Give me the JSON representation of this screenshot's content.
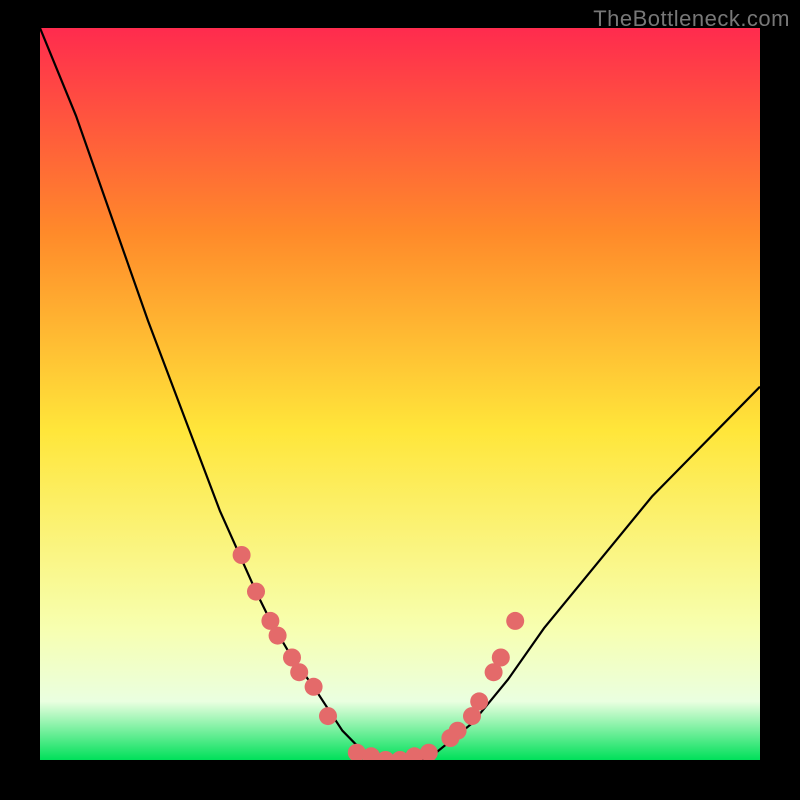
{
  "watermark": "TheBottleneck.com",
  "colors": {
    "page_bg": "#000000",
    "gradient_top": "#ff2b4e",
    "gradient_mid_upper": "#ff8a2a",
    "gradient_mid": "#ffe63a",
    "gradient_lower": "#f7ffb0",
    "gradient_band": "#eaffe0",
    "gradient_bottom": "#00e05a",
    "curve_stroke": "#000000",
    "marker_fill": "#e46a6a"
  },
  "chart_data": {
    "type": "line",
    "title": "",
    "xlabel": "",
    "ylabel": "",
    "x": [
      0,
      5,
      10,
      15,
      20,
      25,
      30,
      32,
      35,
      38,
      40,
      42,
      45,
      48,
      50,
      53,
      55,
      60,
      65,
      70,
      75,
      80,
      85,
      90,
      95,
      100
    ],
    "values": [
      100,
      88,
      74,
      60,
      47,
      34,
      23,
      19,
      14,
      10,
      7,
      4,
      1,
      0,
      0,
      0,
      1,
      5,
      11,
      18,
      24,
      30,
      36,
      41,
      46,
      51
    ],
    "xlim": [
      0,
      100
    ],
    "ylim": [
      0,
      100
    ],
    "markers": {
      "left_cluster_x": [
        28,
        30,
        32,
        33,
        35,
        36,
        38,
        40
      ],
      "left_cluster_y": [
        28,
        23,
        19,
        17,
        14,
        12,
        10,
        6
      ],
      "bottom_cluster_x": [
        44,
        46,
        48,
        50,
        52,
        54
      ],
      "bottom_cluster_y": [
        1,
        0.5,
        0,
        0,
        0.5,
        1
      ],
      "right_cluster_x": [
        57,
        58,
        60,
        61,
        63,
        64,
        66
      ],
      "right_cluster_y": [
        3,
        4,
        6,
        8,
        12,
        14,
        19
      ]
    }
  }
}
